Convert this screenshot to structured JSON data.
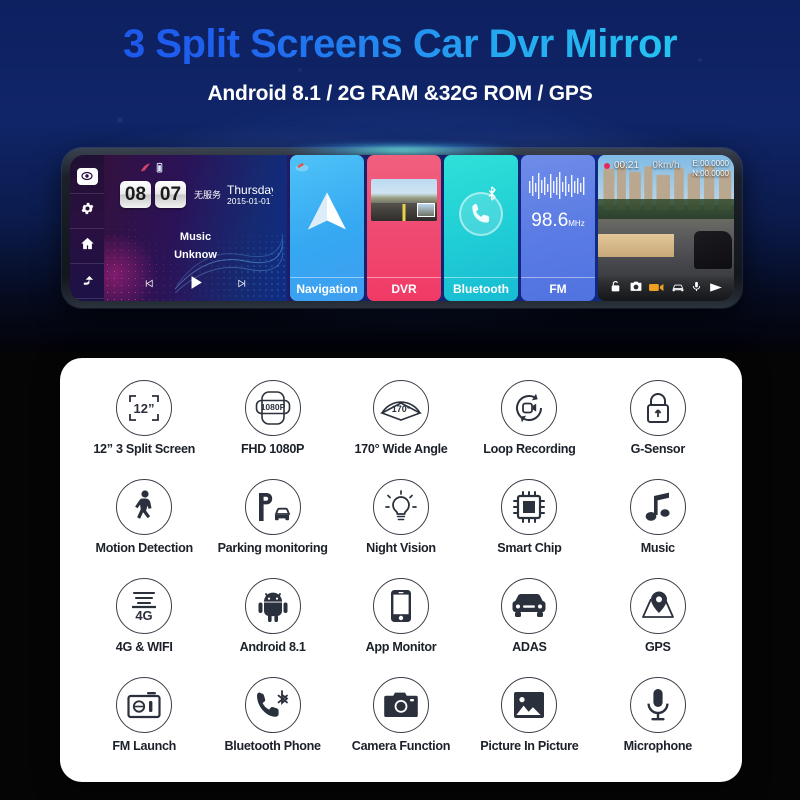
{
  "header": {
    "title": "3 Split Screens Car Dvr Mirror",
    "subtitle": "Android 8.1 / 2G RAM &32G ROM / GPS",
    "title_gradient_start": "#1a4ee8",
    "title_gradient_end": "#22d8f0",
    "background_color": "#0d2060"
  },
  "device": {
    "sidebar": [
      {
        "name": "camera-view-icon",
        "label": "Camera"
      },
      {
        "name": "gear-icon",
        "label": "Settings"
      },
      {
        "name": "home-icon",
        "label": "Home"
      },
      {
        "name": "back-arrow-icon",
        "label": "Back"
      }
    ],
    "home": {
      "hour": "08",
      "minute": "07",
      "carrier": "无服务",
      "weekday": "Thursday",
      "date": "2015-01-01",
      "music_title": "Music",
      "music_artist": "Unknow",
      "controls": [
        "previous-track",
        "play",
        "next-track"
      ]
    },
    "tiles": [
      {
        "label": "Navigation",
        "color": "#35a8f2"
      },
      {
        "label": "DVR",
        "color": "#ef4b72"
      },
      {
        "label": "Bluetooth",
        "color": "#21cfd6"
      },
      {
        "label": "FM",
        "color": "#5b7ce4",
        "frequency": "98.6",
        "frequency_unit": "MHz"
      }
    ],
    "dashcam": {
      "rec_time": "00:21",
      "speed": "0km/h",
      "gps_east": "E:00.0000",
      "gps_north": "N:00.0000",
      "toolbar": [
        "lock-icon",
        "camera-icon",
        "video-icon",
        "car-icon",
        "microphone-icon",
        "play-icon"
      ]
    }
  },
  "features": [
    {
      "label": "12” 3 Split Screen",
      "icon": "split-screen-icon",
      "badge": "12”"
    },
    {
      "label": "FHD 1080P",
      "icon": "resolution-icon",
      "badge": "1080P"
    },
    {
      "label": "170° Wide Angle",
      "icon": "wide-angle-icon",
      "badge": "170°"
    },
    {
      "label": "Loop Recording",
      "icon": "loop-recording-icon",
      "badge": ""
    },
    {
      "label": "G-Sensor",
      "icon": "lock-icon",
      "badge": ""
    },
    {
      "label": "Motion Detection",
      "icon": "walking-person-icon",
      "badge": ""
    },
    {
      "label": "Parking monitoring",
      "icon": "parking-car-icon",
      "badge": ""
    },
    {
      "label": "Night Vision",
      "icon": "lightbulb-icon",
      "badge": ""
    },
    {
      "label": "Smart Chip",
      "icon": "chip-icon",
      "badge": ""
    },
    {
      "label": "Music",
      "icon": "music-note-icon",
      "badge": ""
    },
    {
      "label": "4G & WIFI",
      "icon": "4g-signal-icon",
      "badge": "4G"
    },
    {
      "label": "Android 8.1",
      "icon": "android-icon",
      "badge": ""
    },
    {
      "label": "App Monitor",
      "icon": "smartphone-icon",
      "badge": ""
    },
    {
      "label": "ADAS",
      "icon": "car-front-icon",
      "badge": ""
    },
    {
      "label": "GPS",
      "icon": "map-pin-icon",
      "badge": ""
    },
    {
      "label": "FM Launch",
      "icon": "radio-icon",
      "badge": ""
    },
    {
      "label": "Bluetooth Phone",
      "icon": "bluetooth-phone-icon",
      "badge": ""
    },
    {
      "label": "Camera Function",
      "icon": "photo-camera-icon",
      "badge": ""
    },
    {
      "label": "Picture In Picture",
      "icon": "picture-icon",
      "badge": ""
    },
    {
      "label": "Microphone",
      "icon": "microphone-icon",
      "badge": ""
    }
  ]
}
